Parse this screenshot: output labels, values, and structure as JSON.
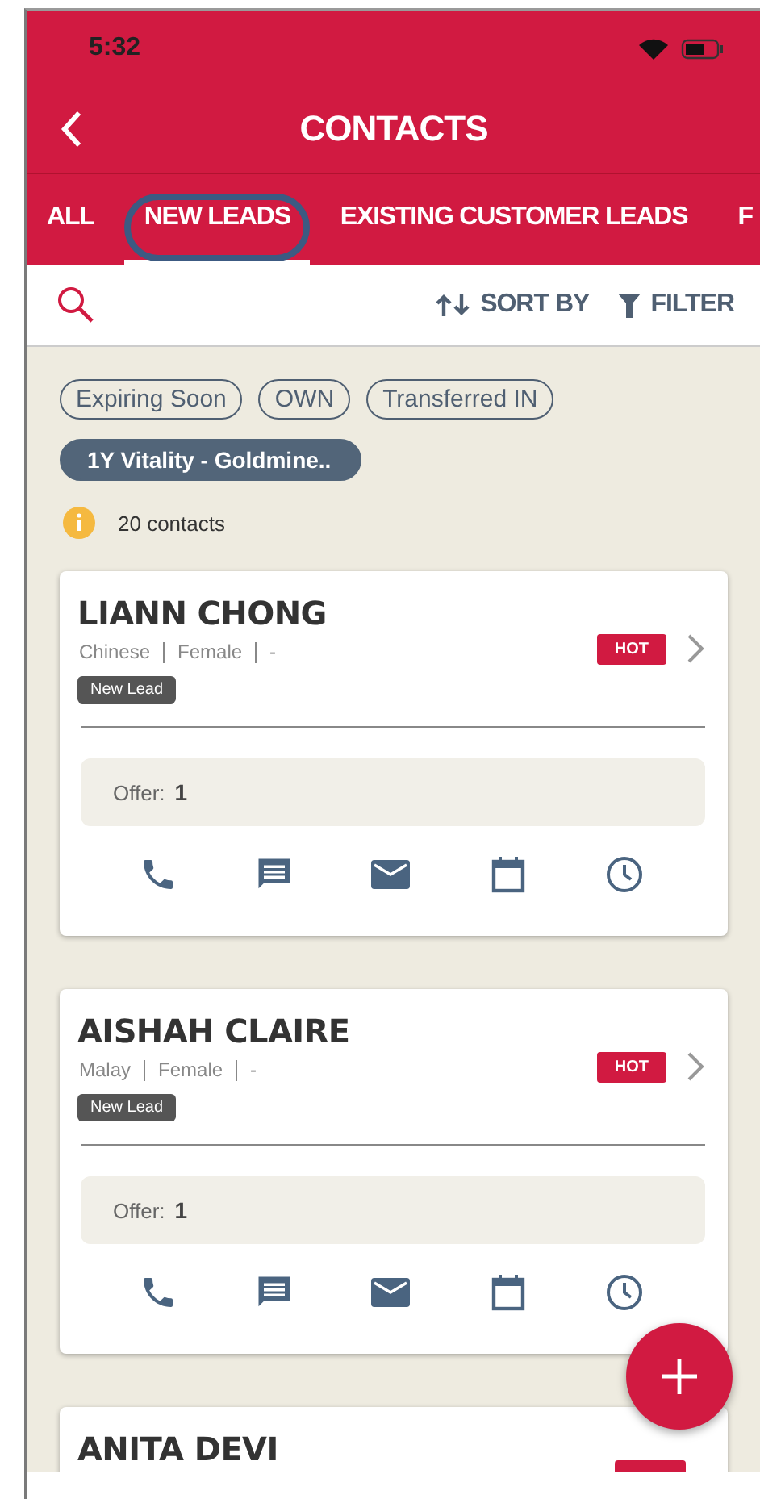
{
  "status_bar": {
    "time": "5:32"
  },
  "header": {
    "title": "CONTACTS"
  },
  "tabs": [
    {
      "label": "ALL",
      "selected": false
    },
    {
      "label": "NEW LEADS",
      "selected": true
    },
    {
      "label": "EXISTING CUSTOMER LEADS",
      "selected": false
    },
    {
      "label": "F",
      "selected": false
    }
  ],
  "toolbar": {
    "sort": "SORT BY",
    "filter": "FILTER"
  },
  "chips": [
    {
      "label": "Expiring Soon",
      "selected": false
    },
    {
      "label": "OWN",
      "selected": false
    },
    {
      "label": "Transferred IN",
      "selected": false
    },
    {
      "label": "1Y Vitality - Goldmine..",
      "selected": true
    }
  ],
  "count": "20 contacts",
  "contacts": [
    {
      "name": "LIANN CHONG",
      "details": [
        "Chinese",
        "Female",
        "-"
      ],
      "tag": "New Lead",
      "priority": "HOT",
      "offer_label": "Offer:",
      "offer": "1"
    },
    {
      "name": "AISHAH CLAIRE",
      "details": [
        "Malay",
        "Female",
        "-"
      ],
      "tag": "New Lead",
      "priority": "HOT",
      "offer_label": "Offer:",
      "offer": "1"
    },
    {
      "name": "ANITA DEVI"
    }
  ]
}
